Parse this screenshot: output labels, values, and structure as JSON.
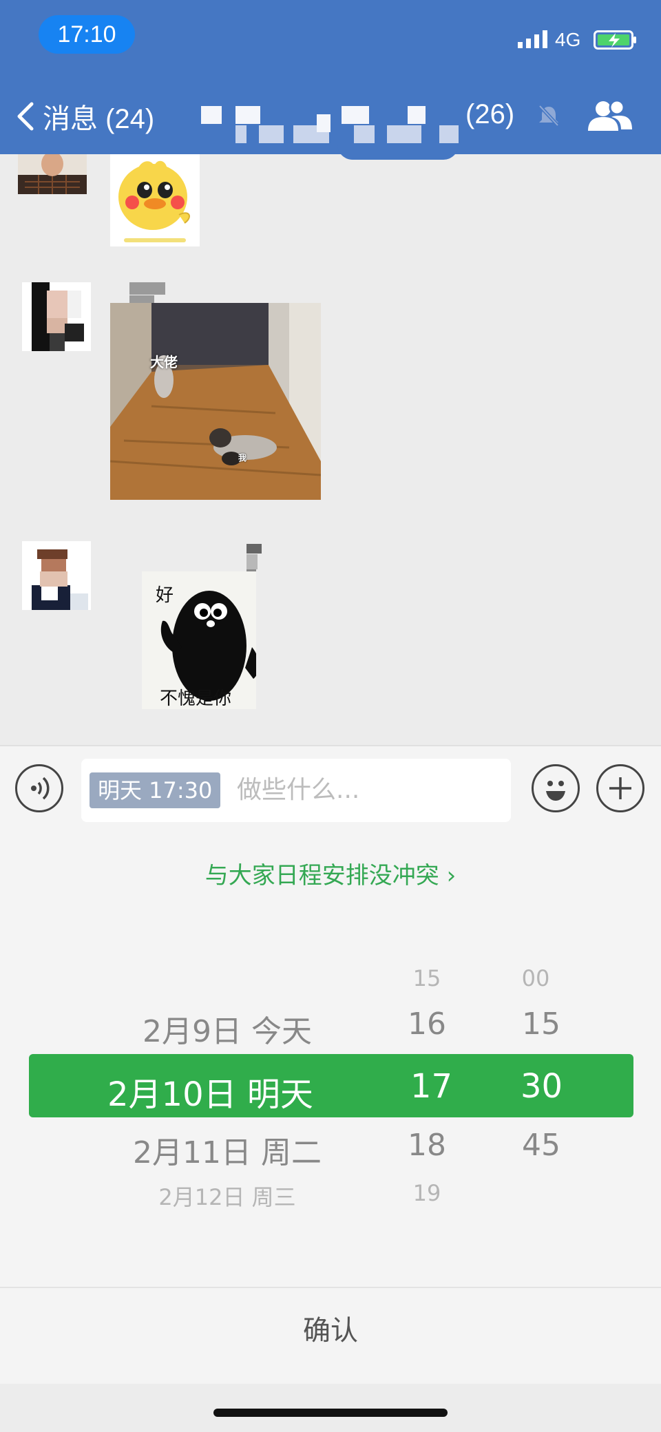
{
  "status_bar": {
    "time": "17:10",
    "network": "4G"
  },
  "header": {
    "back_label": "消息 (24)",
    "member_count": "(26)"
  },
  "composer": {
    "time_tag": "明天 17:30",
    "placeholder": "做些什么..."
  },
  "schedule_hint": "与大家日程安排没冲突 ›",
  "picker": {
    "dates": [
      "2月9日 今天",
      "2月10日 明天",
      "2月11日 周二",
      "2月12日 周三"
    ],
    "hours": [
      "15",
      "16",
      "17",
      "18",
      "19"
    ],
    "minutes": [
      "00",
      "15",
      "30",
      "45"
    ],
    "selected": {
      "date": "2月10日 明天",
      "hour": "17",
      "minute": "30"
    }
  },
  "confirm_label": "确认",
  "stickers": {
    "cats_top": "大佬",
    "cats_bottom": "我",
    "penguin_top": "好",
    "penguin_bottom": "不愧是你"
  }
}
